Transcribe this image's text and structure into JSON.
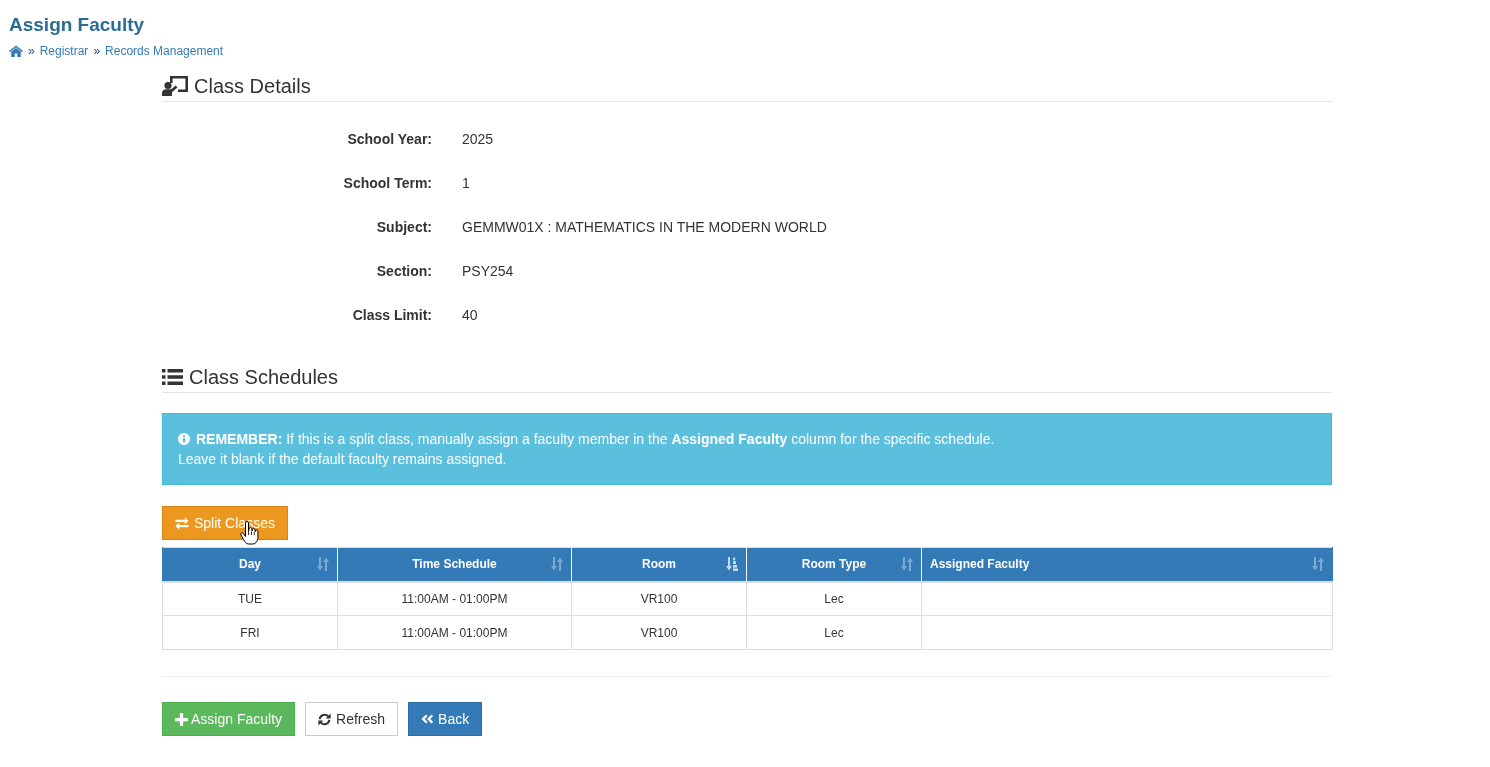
{
  "page": {
    "title": "Assign Faculty"
  },
  "breadcrumb": [
    {
      "kind": "home"
    },
    {
      "kind": "separator",
      "text": "»"
    },
    {
      "kind": "link",
      "text": "Registrar"
    },
    {
      "kind": "separator",
      "text": "»"
    },
    {
      "kind": "link",
      "text": "Records Management"
    }
  ],
  "class_details": {
    "heading": "Class Details",
    "fields": [
      {
        "label": "School Year:",
        "value": "2025"
      },
      {
        "label": "School Term:",
        "value": "1"
      },
      {
        "label": "Subject:",
        "value": "GEMMW01X : MATHEMATICS IN THE MODERN WORLD"
      },
      {
        "label": "Section:",
        "value": "PSY254"
      },
      {
        "label": "Class Limit:",
        "value": "40"
      }
    ]
  },
  "class_schedules": {
    "heading": "Class Schedules",
    "alert": {
      "lines": [
        "**REMEMBER:** If this is a split class, manually assign a faculty member in the **Assigned Faculty** column for the specific schedule.",
        "Leave it blank if the default faculty remains assigned."
      ]
    },
    "split_button": {
      "label": "Split Classes"
    },
    "table": {
      "columns": [
        {
          "label": "Day",
          "sorted": false
        },
        {
          "label": "Time Schedule",
          "sorted": false
        },
        {
          "label": "Room",
          "sorted": true
        },
        {
          "label": "Room Type",
          "sorted": false
        },
        {
          "label": "Assigned Faculty",
          "sorted": false
        }
      ],
      "rows": [
        {
          "cells": [
            "TUE",
            "11:00AM - 01:00PM",
            "VR100",
            "Lec"
          ]
        },
        {
          "cells": [
            "FRI",
            "11:00AM - 01:00PM",
            "VR100",
            "Lec"
          ]
        }
      ]
    }
  },
  "actions": [
    {
      "kind": "add",
      "label": "Assign Faculty"
    },
    {
      "kind": "refresh",
      "label": "Refresh"
    },
    {
      "kind": "back",
      "label": "Back"
    }
  ]
}
